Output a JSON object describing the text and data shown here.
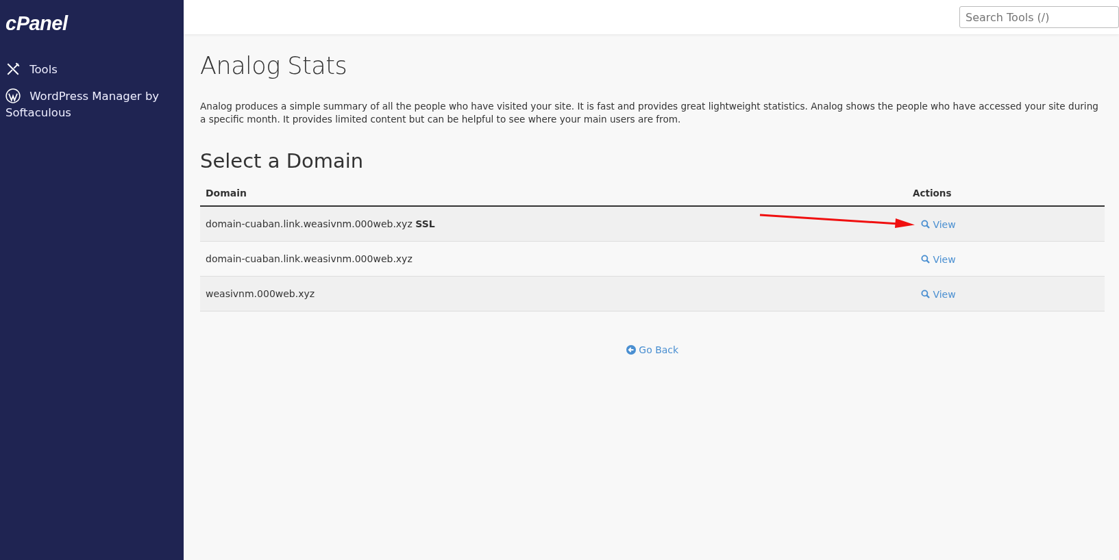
{
  "sidebar": {
    "logo": "cPanel",
    "items": [
      {
        "label": "Tools",
        "kind": "tools"
      },
      {
        "label": "WordPress Manager by Softaculous",
        "kind": "wordpress"
      }
    ]
  },
  "search": {
    "placeholder": "Search Tools (/)"
  },
  "page": {
    "title": "Analog Stats",
    "description": "Analog produces a simple summary of all the people who have visited your site. It is fast and provides great lightweight statistics. Analog shows the people who have accessed your site during a specific month. It provides limited content but can be helpful to see where your main users are from.",
    "subtitle": "Select a Domain"
  },
  "table": {
    "columns": [
      "Domain",
      "Actions"
    ],
    "rows": [
      {
        "domain": "domain-cuaban.link.weasivnm.000web.xyz **SSL**",
        "action": "View"
      },
      {
        "domain": "domain-cuaban.link.weasivnm.000web.xyz",
        "action": "View"
      },
      {
        "domain": "weasivnm.000web.xyz",
        "action": "View"
      }
    ]
  },
  "go_back": "Go Back"
}
